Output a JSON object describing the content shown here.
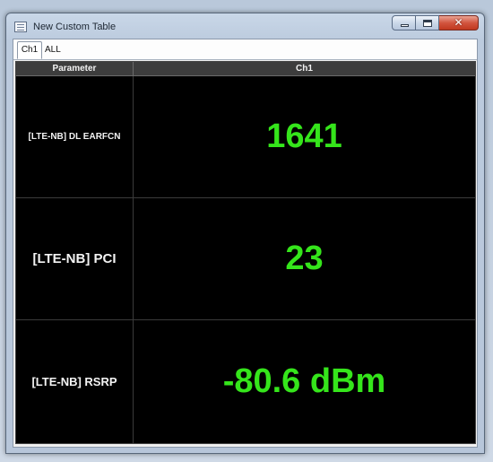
{
  "window": {
    "title": "New Custom Table",
    "close_glyph": "✕"
  },
  "tabs": [
    {
      "label": "Ch1",
      "active": true
    },
    {
      "label": "ALL",
      "active": false
    }
  ],
  "table": {
    "columns": [
      "Parameter",
      "Ch1"
    ],
    "rows": [
      {
        "parameter": "[LTE-NB] DL EARFCN",
        "value": "1641"
      },
      {
        "parameter": "[LTE-NB] PCI",
        "value": "23"
      },
      {
        "parameter": "[LTE-NB] RSRP",
        "value": "-80.6 dBm"
      }
    ]
  },
  "colors": {
    "value_text": "#35e51b",
    "grid_background": "#000000",
    "header_background": "#3d3d3d",
    "close_button": "#c9452d"
  },
  "icons": {
    "app": "table-window-icon",
    "minimize": "minimize-icon",
    "maximize": "maximize-icon",
    "close": "close-icon"
  }
}
